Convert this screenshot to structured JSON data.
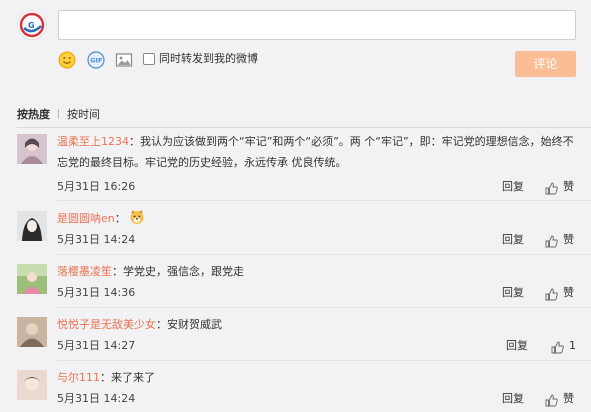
{
  "composer": {
    "input_value": "",
    "forward_label": "同时转发到我的微博",
    "submit_label": "评论",
    "forward_checked": false
  },
  "sort": {
    "hot_label": "按热度",
    "time_label": "按时间"
  },
  "comments": [
    {
      "user": "温柔至上1234",
      "text": "：我认为应该做到两个“牢记”和两个“必须”。两 个“牢记”，即：牢记党的理想信念，始终不忘党的最终目标。牢记党的历史经验，永远传承 优良传统。",
      "time": "5月31日 16:26",
      "reply": "回复",
      "like": "赞"
    },
    {
      "user": "是圆圆呐en",
      "text": "：",
      "emoji": "dog-face-emoji",
      "time": "5月31日 14:24",
      "reply": "回复",
      "like": "赞"
    },
    {
      "user": "落樱墨凌笙",
      "text": "：学党史，强信念，跟党走",
      "time": "5月31日 14:36",
      "reply": "回复",
      "like": "赞"
    },
    {
      "user": "悦悦子是无敌美少女",
      "text": "：安财贺威武",
      "time": "5月31日 14:27",
      "reply": "回复",
      "like": "1"
    },
    {
      "user": "与尔111",
      "text": "：来了来了",
      "time": "5月31日 14:24",
      "reply": "回复",
      "like": "赞"
    }
  ],
  "colors": {
    "accent": "#eb7350",
    "submit_bg": "#fbbd93",
    "background": "#f2f2f5"
  },
  "icons": [
    "emoji-icon",
    "gif-icon",
    "image-icon",
    "thumbs-up-icon"
  ]
}
